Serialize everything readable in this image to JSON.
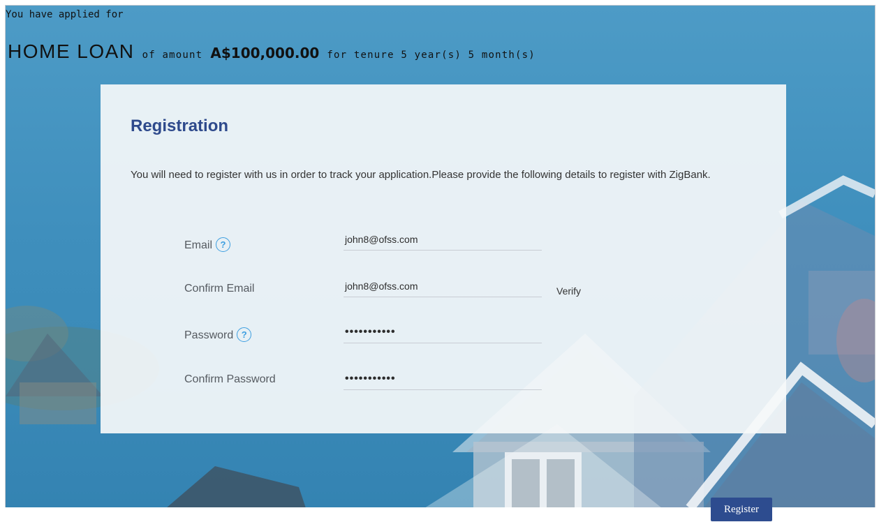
{
  "header": {
    "applied_text": "You have applied for",
    "loan_product": "HOME LOAN",
    "of_amount_text": "of amount",
    "amount": "A$100,000.00",
    "tenure_text": "for tenure 5 year(s) 5 month(s)"
  },
  "registration": {
    "title": "Registration",
    "description": "You will need to register with us in order to track your application.Please provide the following details to register with ZigBank.",
    "fields": {
      "email": {
        "label": "Email",
        "value": "john8@ofss.com",
        "help_icon": "question-circle-icon"
      },
      "confirm_email": {
        "label": "Confirm Email",
        "value": "john8@ofss.com",
        "verify_label": "Verify"
      },
      "password": {
        "label": "Password",
        "value": "•••••••••••",
        "help_icon": "question-circle-icon"
      },
      "confirm_password": {
        "label": "Confirm Password",
        "value": "•••••••••••"
      }
    },
    "help_glyph": "?"
  },
  "actions": {
    "register_label": "Register"
  },
  "colors": {
    "title": "#2e4a8c",
    "help_icon": "#3c9ee0",
    "register_button": "#2d4c8f",
    "sky": "#3f8fbd"
  }
}
